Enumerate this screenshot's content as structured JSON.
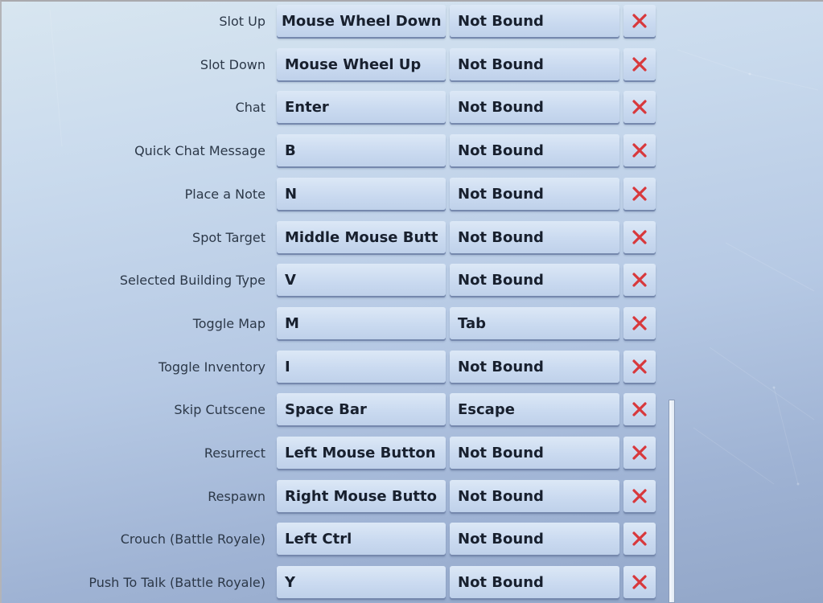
{
  "keybinds": {
    "rows": [
      {
        "action": "Slot Up",
        "primary": "Mouse Wheel Down",
        "secondary": "Not Bound"
      },
      {
        "action": "Slot Down",
        "primary": "Mouse Wheel Up",
        "secondary": "Not Bound"
      },
      {
        "action": "Chat",
        "primary": "Enter",
        "secondary": "Not Bound"
      },
      {
        "action": "Quick Chat Message",
        "primary": "B",
        "secondary": "Not Bound"
      },
      {
        "action": "Place a Note",
        "primary": "N",
        "secondary": "Not Bound"
      },
      {
        "action": "Spot Target",
        "primary": "Middle Mouse Butt",
        "secondary": "Not Bound"
      },
      {
        "action": "Selected Building Type",
        "primary": "V",
        "secondary": "Not Bound"
      },
      {
        "action": "Toggle Map",
        "primary": "M",
        "secondary": "Tab"
      },
      {
        "action": "Toggle Inventory",
        "primary": "I",
        "secondary": "Not Bound"
      },
      {
        "action": "Skip Cutscene",
        "primary": "Space Bar",
        "secondary": "Escape"
      },
      {
        "action": "Resurrect",
        "primary": "Left Mouse Button",
        "secondary": "Not Bound"
      },
      {
        "action": "Respawn",
        "primary": "Right Mouse Butto",
        "secondary": "Not Bound"
      },
      {
        "action": "Crouch (Battle Royale)",
        "primary": "Left Ctrl",
        "secondary": "Not Bound"
      },
      {
        "action": "Push To Talk (Battle Royale)",
        "primary": "Y",
        "secondary": "Not Bound"
      }
    ],
    "clear_icon": "close-x-icon",
    "clear_icon_color": "#d8383c"
  },
  "scrollbar": {
    "position_fraction": 0.66,
    "visible_fraction": 0.34
  }
}
